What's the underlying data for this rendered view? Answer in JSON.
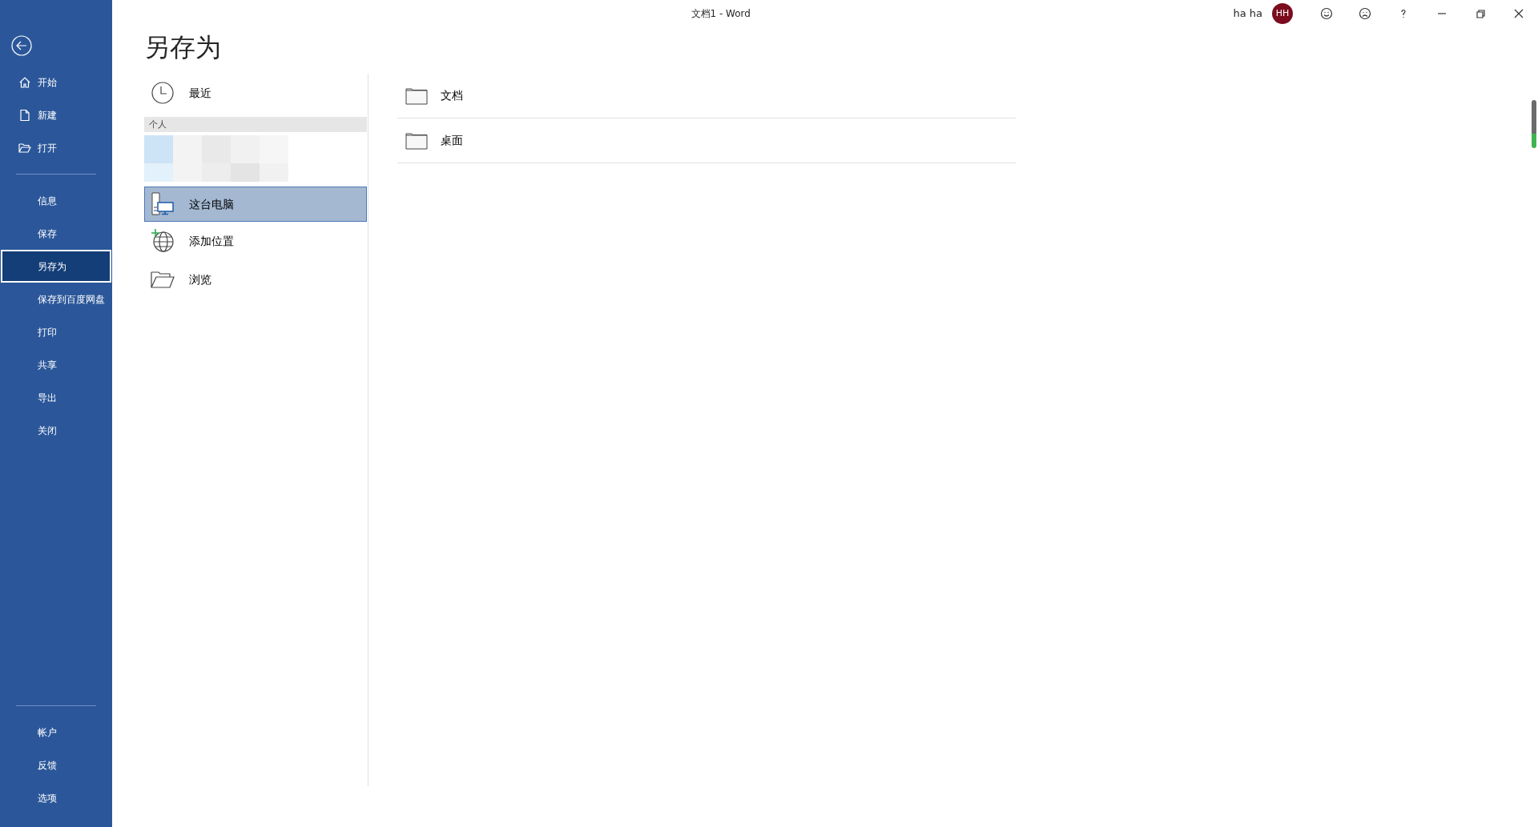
{
  "window": {
    "title": "文档1  -  Word",
    "user_name": "ha ha",
    "user_initials": "HH"
  },
  "sidebar": {
    "top_items": [
      {
        "label": "开始",
        "selected": false
      },
      {
        "label": "新建",
        "selected": false
      },
      {
        "label": "打开",
        "selected": false
      }
    ],
    "middle_items": [
      {
        "label": "信息",
        "selected": false
      },
      {
        "label": "保存",
        "selected": false
      },
      {
        "label": "另存为",
        "selected": true
      },
      {
        "label": "保存到百度网盘",
        "selected": false
      },
      {
        "label": "打印",
        "selected": false
      },
      {
        "label": "共享",
        "selected": false
      },
      {
        "label": "导出",
        "selected": false
      },
      {
        "label": "关闭",
        "selected": false
      }
    ],
    "bottom_items": [
      {
        "label": "帐户",
        "selected": false
      },
      {
        "label": "反馈",
        "selected": false
      },
      {
        "label": "选项",
        "selected": false
      }
    ]
  },
  "page_title": "另存为",
  "places": [
    {
      "kind": "recent",
      "label": "最近",
      "selected": false
    },
    {
      "kind": "header",
      "label": "个人"
    },
    {
      "kind": "blurred"
    },
    {
      "kind": "pc",
      "label": "这台电脑",
      "selected": true
    },
    {
      "kind": "add",
      "label": "添加位置",
      "selected": false
    },
    {
      "kind": "browse",
      "label": "浏览",
      "selected": false
    }
  ],
  "folders": [
    {
      "label": "文档"
    },
    {
      "label": "桌面"
    }
  ]
}
